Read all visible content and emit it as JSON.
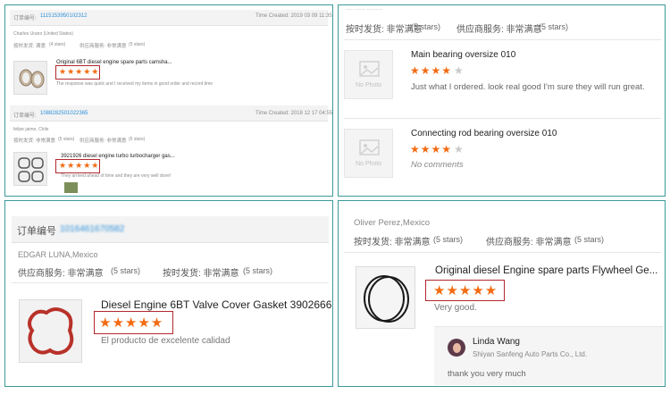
{
  "p1": {
    "r1": {
      "order_label": "订单编号:",
      "order_no": "1115153950102312",
      "time": "Time Created: 2019 03 09 11:35",
      "buyer": "Charles Urano (United States)",
      "ship_label": "按时发货: 满意",
      "ship_stars": "(4 stars)",
      "svc_label": "供应商服务: 非常满意",
      "svc_stars": "(5 stars)",
      "product": "Original 6BT diesel engine spare parts camsha...",
      "stars": "★★★★★",
      "comment": "The response was quick and I received my items in good order and record time"
    },
    "r2": {
      "order_label": "订单编号:",
      "order_no": "1088282501022365",
      "time": "Time Created: 2018 12 17 04:55",
      "buyer": "felipe jaime, Chile",
      "ship_label": "按时发货: 非常满意",
      "ship_stars": "(5 stars)",
      "svc_label": "供应商服务: 非常满意",
      "svc_stars": "(5 stars)",
      "product": "3921926 diesel engine turbo turbocharger gas...",
      "stars": "★★★★★",
      "comment": "They arrived ahead of time and they are very well done!"
    }
  },
  "p2": {
    "header_cut": "----  ------ ---------",
    "ship_label": "按时发货: 非常满意",
    "ship_stars": "(5 stars)",
    "svc_label": "供应商服务: 非常满意",
    "svc_stars": "(5 stars)",
    "no_photo": "No Photo",
    "items": [
      {
        "title": "Main bearing oversize 010",
        "stars_on": "★★★★",
        "stars_off": "★",
        "rating": 4,
        "comment": "Just what I ordered. look real good I'm sure they will run great."
      },
      {
        "title": "Connecting rod bearing oversize 010",
        "stars_on": "★★★★",
        "stars_off": "★",
        "rating": 4,
        "comment": "No comments"
      }
    ]
  },
  "p3": {
    "order_label": "订单编号",
    "order_no": "1016461670582",
    "buyer": "EDGAR LUNA,Mexico",
    "svc_label": "供应商服务: 非常满意",
    "svc_stars": "(5 stars)",
    "ship_label": "按时发货: 非常满意",
    "ship_stars": "(5 stars)",
    "product": "Diesel Engine 6BT Valve Cover Gasket 3902666",
    "stars": "★★★★★",
    "comment": "El producto de excelente calidad"
  },
  "p4": {
    "buyer": "Oliver Perez,Mexico",
    "ship_label": "按时发货: 非常满意",
    "ship_stars": "(5 stars)",
    "svc_label": "供应商服务: 非常满意",
    "svc_stars": "(5 stars)",
    "product": "Original diesel Engine spare parts Flywheel Ge...",
    "stars": "★★★★★",
    "comment": "Very good.",
    "reply_name": "Linda Wang",
    "reply_company": "Shiyan Sanfeng Auto Parts Co., Ltd.",
    "reply_text": "thank you very much"
  },
  "colors": {
    "frame": "#3a9a98",
    "star": "#f26b12",
    "highlight": "#b3282e",
    "link": "#2d8fd8"
  }
}
